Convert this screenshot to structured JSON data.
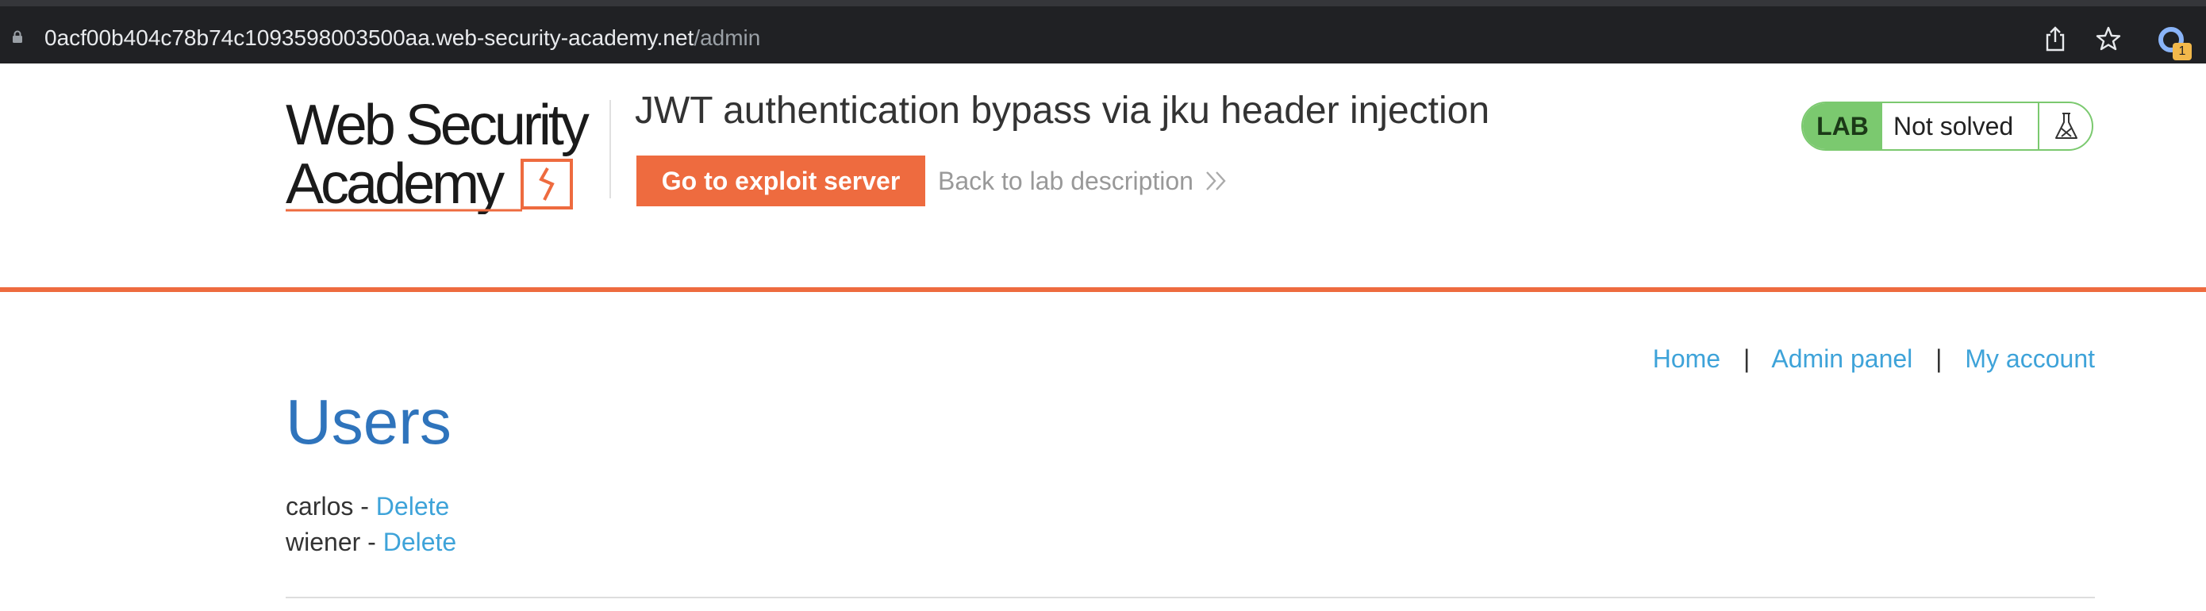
{
  "browser": {
    "url_host": "0acf00b404c78b74c1093598003500aa.web-security-academy.net",
    "url_path": "/admin",
    "extension_badge": "1"
  },
  "header": {
    "logo_text": "Web Security Academy",
    "lab_title": "JWT authentication bypass via jku header injection",
    "exploit_button_label": "Go to exploit server",
    "back_link_label": "Back to lab description",
    "lab_badge": "LAB",
    "lab_status": "Not solved"
  },
  "nav": {
    "items": [
      {
        "label": "Home"
      },
      {
        "label": "Admin panel"
      },
      {
        "label": "My account"
      }
    ],
    "separator": "|"
  },
  "main": {
    "heading": "Users",
    "users": [
      {
        "name": "carlos",
        "separator": " - ",
        "action": "Delete"
      },
      {
        "name": "wiener",
        "separator": " - ",
        "action": "Delete"
      }
    ]
  },
  "colors": {
    "accent": "#ee6b3f",
    "heading_blue": "#2f74bc",
    "link_blue": "#3ea3d9",
    "lab_green": "#7bc96f"
  }
}
